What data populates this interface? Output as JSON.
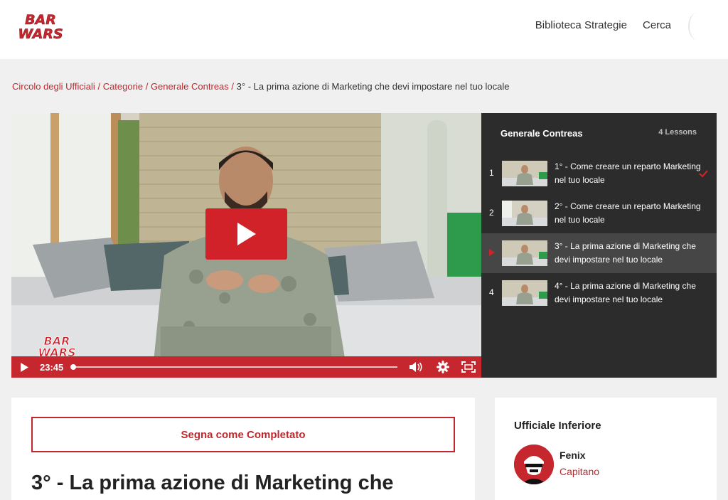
{
  "brand": {
    "logo_line1": "BAR",
    "logo_line2": "WARS",
    "accent_color": "#c6262d",
    "dark_panel_color": "#2c2c2c"
  },
  "nav": {
    "items": [
      "Biblioteca Strategie",
      "Cerca"
    ]
  },
  "breadcrumb": {
    "items": [
      "Circolo degli Ufficiali",
      "Categorie",
      "Generale Contreas"
    ],
    "separator": "/",
    "current": "3° - La prima azione di Marketing che devi impostare nel tuo locale"
  },
  "video": {
    "time": "23:45",
    "play_icon": "play-icon",
    "volume_icon": "volume-icon",
    "settings_icon": "gear-icon",
    "fullscreen_icon": "fullscreen-icon",
    "progress_fraction": 0.0
  },
  "lessons_panel": {
    "title": "Generale Contreas",
    "count": "4 Lessons",
    "lessons": [
      {
        "num": "1",
        "title": "1° - Come creare un reparto Marketing nel tuo locale",
        "completed": true,
        "active": false
      },
      {
        "num": "2",
        "title": "2° - Come creare un reparto Marketing nel tuo locale",
        "completed": false,
        "active": false
      },
      {
        "num": "",
        "title": "3° - La prima azione di Marketing che devi impostare nel tuo locale",
        "completed": false,
        "active": true
      },
      {
        "num": "4",
        "title": "4° - La prima azione di Marketing che devi impostare nel tuo locale",
        "completed": false,
        "active": false
      }
    ]
  },
  "content": {
    "complete_button": "Segna come Completato",
    "heading": "3° - La prima azione di Marketing che"
  },
  "sidebar": {
    "title": "Ufficiale Inferiore",
    "user_name": "Fenix",
    "user_role": "Capitano"
  }
}
